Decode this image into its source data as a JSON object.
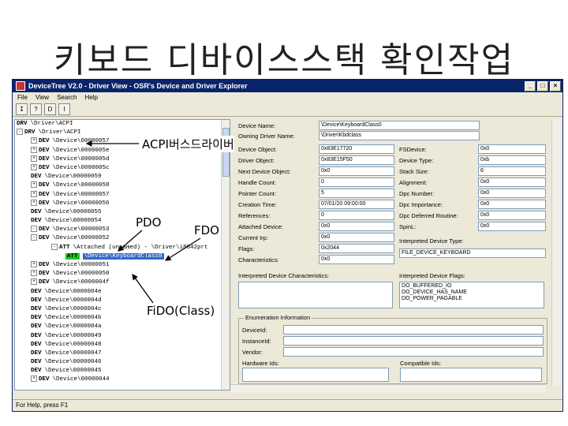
{
  "slide": {
    "title": "키보드 디바이스스택 확인작업"
  },
  "window": {
    "title": "DeviceTree V2.0 - Driver View - OSR's Device and Driver Explorer",
    "menu": [
      "File",
      "View",
      "Search",
      "Help"
    ],
    "toolbar": [
      "↧",
      "?",
      "D",
      "I"
    ],
    "status": "For Help, press F1"
  },
  "tree": [
    {
      "pm": "",
      "type": "DRV",
      "text": "\\Driver\\ACPI",
      "sel": false,
      "att": false
    },
    {
      "pm": "-",
      "type": "DRV",
      "text": "\\Driver\\ACPI",
      "sel": false,
      "att": false
    },
    {
      "pm": "+",
      "type": "DEV",
      "text": "\\Device\\00000057",
      "sel": false,
      "att": false
    },
    {
      "pm": "+",
      "type": "DEV",
      "text": "\\Device\\0000005e",
      "sel": false,
      "att": false
    },
    {
      "pm": "+",
      "type": "DEV",
      "text": "\\Device\\0000005d",
      "sel": false,
      "att": false
    },
    {
      "pm": "+",
      "type": "DEV",
      "text": "\\Device\\0000005c",
      "sel": false,
      "att": false
    },
    {
      "pm": "",
      "type": "DEV",
      "text": "\\Device\\00000059",
      "sel": false,
      "att": false
    },
    {
      "pm": "+",
      "type": "DEV",
      "text": "\\Device\\00000058",
      "sel": false,
      "att": false
    },
    {
      "pm": "+",
      "type": "DEV",
      "text": "\\Device\\00000057",
      "sel": false,
      "att": false
    },
    {
      "pm": "+",
      "type": "DEV",
      "text": "\\Device\\00000056",
      "sel": false,
      "att": false
    },
    {
      "pm": "",
      "type": "DEV",
      "text": "\\Device\\00000055",
      "sel": false,
      "att": false
    },
    {
      "pm": "",
      "type": "DEV",
      "text": "\\Device\\00000054",
      "sel": false,
      "att": false
    },
    {
      "pm": "-",
      "type": "DEV",
      "text": "\\Device\\00000053",
      "sel": false,
      "att": false
    },
    {
      "pm": "-",
      "type": "DEV",
      "text": "\\Device\\00000052",
      "sel": false,
      "att": false
    },
    {
      "pm": "-",
      "type": "ATT",
      "text": "\\Attached (unnamed) - \\Driver\\i8042prt",
      "sel": false,
      "att": false
    },
    {
      "pm": "",
      "type": "ATT",
      "text": "\\Device\\KeyboardClass0",
      "sel": true,
      "att": true
    },
    {
      "pm": "+",
      "type": "DEV",
      "text": "\\Device\\00000051",
      "sel": false,
      "att": false
    },
    {
      "pm": "+",
      "type": "DEV",
      "text": "\\Device\\00000050",
      "sel": false,
      "att": false
    },
    {
      "pm": "+",
      "type": "DEV",
      "text": "\\Device\\0000004f",
      "sel": false,
      "att": false
    },
    {
      "pm": "",
      "type": "DEV",
      "text": "\\Device\\0000004e",
      "sel": false,
      "att": false
    },
    {
      "pm": "",
      "type": "DEV",
      "text": "\\Device\\0000004d",
      "sel": false,
      "att": false
    },
    {
      "pm": "",
      "type": "DEV",
      "text": "\\Device\\0000004c",
      "sel": false,
      "att": false
    },
    {
      "pm": "",
      "type": "DEV",
      "text": "\\Device\\0000004b",
      "sel": false,
      "att": false
    },
    {
      "pm": "",
      "type": "DEV",
      "text": "\\Device\\0000004a",
      "sel": false,
      "att": false
    },
    {
      "pm": "",
      "type": "DEV",
      "text": "\\Device\\00000049",
      "sel": false,
      "att": false
    },
    {
      "pm": "",
      "type": "DEV",
      "text": "\\Device\\00000048",
      "sel": false,
      "att": false
    },
    {
      "pm": "",
      "type": "DEV",
      "text": "\\Device\\00000047",
      "sel": false,
      "att": false
    },
    {
      "pm": "",
      "type": "DEV",
      "text": "\\Device\\00000046",
      "sel": false,
      "att": false
    },
    {
      "pm": "",
      "type": "DEV",
      "text": "\\Device\\00000045",
      "sel": false,
      "att": false
    },
    {
      "pm": "+",
      "type": "DEV",
      "text": "\\Device\\00000044",
      "sel": false,
      "att": false
    }
  ],
  "details": {
    "device_name_label": "Device Name:",
    "device_name": "\\Device\\KeyboardClass0",
    "owning_driver_label": "Owning Driver Name:",
    "owning_driver": "\\Driver\\Kbdclass",
    "device_object_label": "Device Object:",
    "device_object": "0x83E17720",
    "driver_object_label": "Driver Object:",
    "driver_object": "0x83E15F50",
    "next_device_label": "Next Device Object:",
    "next_device": "0x0",
    "handle_count_label": "Handle Count:",
    "handle_count": "0",
    "pointer_count_label": "Pointer Count:",
    "pointer_count": "5",
    "creation_time_label": "Creation Time:",
    "creation_time": "07/01/20 09:00:00",
    "references_label": "References:",
    "references": "0",
    "attached_device_label": "Attached Device:",
    "attached_device": "0x0",
    "current_irp_label": "Current Irp:",
    "current_irp": "0x0",
    "flags_label": "Flags:",
    "flags": "0x2044",
    "characteristics_label": "Characteristics:",
    "characteristics": "0x0",
    "fs_device_label": "FSDevice:",
    "fs_device": "0x0",
    "device_type_label": "Device Type:",
    "device_type": "0xb",
    "stack_size_label": "Stack Size:",
    "stack_size": "6",
    "alignment_label": "Alignment:",
    "alignment": "0x0",
    "dpc_number_label": "Dpc Number:",
    "dpc_number": "0x0",
    "dpc_importance_label": "Dpc Importance:",
    "dpc_importance": "0x0",
    "dpc_deferred_label": "Dpc Deferred Routine:",
    "dpc_deferred": "0x0",
    "spin_label": "SpinL:",
    "spin": "0x0",
    "interp_type_label": "Interpreted Device Type:",
    "interp_type": "FILE_DEVICE_KEYBOARD",
    "interp_char_label": "Interpreted Device Characteristics:",
    "interp_flags_label": "Interpreted Device Flags:",
    "interp_flags": [
      "DO_BUFFERED_IO",
      "DO_DEVICE_HAS_NAME",
      "DO_POWER_PAGABLE"
    ],
    "enum_group_label": "Enumeration Information",
    "device_id_label": "DeviceId:",
    "instance_id_label": "InstanceId:",
    "vendor_label": "Vendor:",
    "hardware_ids_label": "Hardware Ids:",
    "compatible_ids_label": "Compatible Ids:"
  },
  "annotations": {
    "acpi": "ACPI버스드라이버",
    "pdo": "PDO",
    "fdo": "FDO",
    "fido": "FiDO(Class)"
  }
}
